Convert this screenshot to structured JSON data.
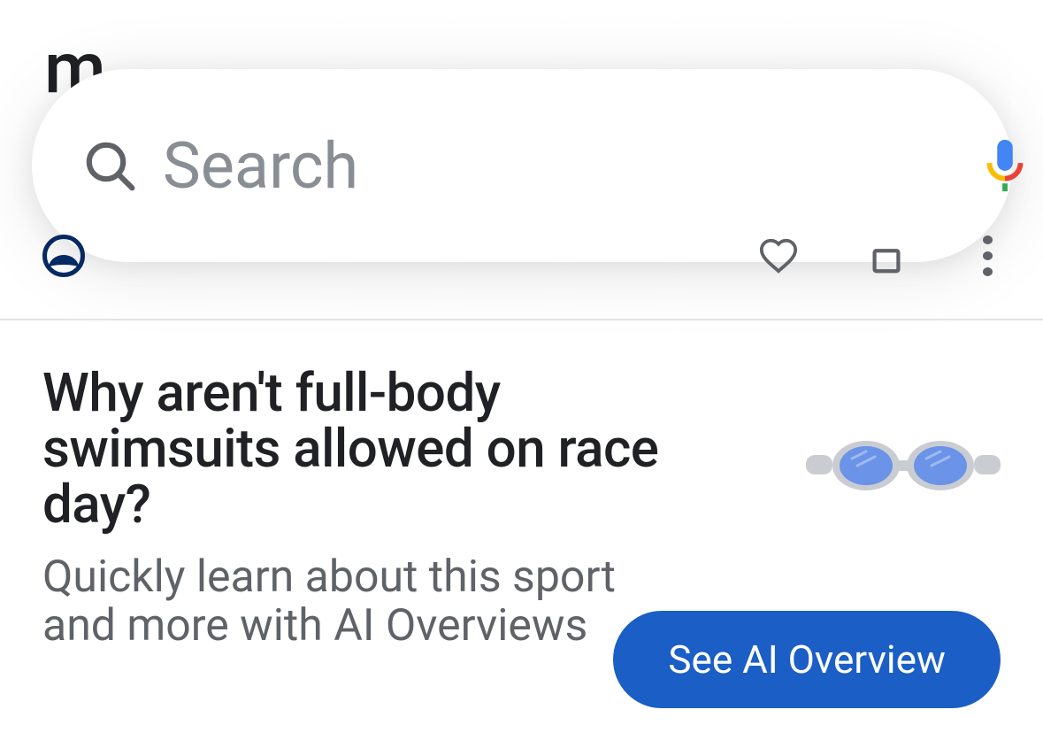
{
  "search": {
    "placeholder": "Search"
  },
  "ai_card": {
    "heading": "Why aren't full-body swimsuits allowed on race day?",
    "subtitle": "Quickly learn about this sport and more with AI Overviews",
    "cta_label": "See AI Overview"
  },
  "colors": {
    "brand_blue": "#1a5ec6",
    "text_primary": "#202124",
    "text_secondary": "#5f6368"
  }
}
